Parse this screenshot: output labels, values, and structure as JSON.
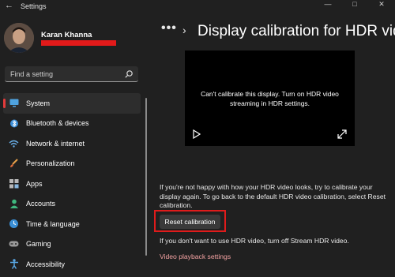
{
  "window": {
    "title": "Settings",
    "back_icon": "back-arrow-icon",
    "controls": [
      "minimize",
      "maximize",
      "close"
    ]
  },
  "profile": {
    "name": "Karan Khanna",
    "redaction_color": "#e21a1a"
  },
  "search": {
    "placeholder": "Find a setting",
    "icon": "search-icon"
  },
  "sidebar": {
    "items": [
      {
        "label": "System",
        "icon": "monitor-icon",
        "selected": true
      },
      {
        "label": "Bluetooth & devices",
        "icon": "bluetooth-icon"
      },
      {
        "label": "Network & internet",
        "icon": "wifi-icon"
      },
      {
        "label": "Personalization",
        "icon": "brush-icon"
      },
      {
        "label": "Apps",
        "icon": "apps-icon"
      },
      {
        "label": "Accounts",
        "icon": "person-icon"
      },
      {
        "label": "Time & language",
        "icon": "globe-clock-icon"
      },
      {
        "label": "Gaming",
        "icon": "gamepad-icon"
      },
      {
        "label": "Accessibility",
        "icon": "accessibility-icon"
      }
    ],
    "accent_color": "#e23b3b"
  },
  "header": {
    "more": "•••",
    "chevron": "›",
    "title": "Display calibration for HDR vide"
  },
  "video": {
    "message": "Can't calibrate this display. Turn on HDR video streaming in HDR settings.",
    "play_icon": "play-icon",
    "expand_icon": "expand-icon"
  },
  "content": {
    "info": "If you're not happy with how your HDR video looks, try to calibrate your display again. To go back to the default HDR video calibration, select Reset calibration.",
    "reset_label": "Reset calibration",
    "stream_text": "If you don't want to use HDR video, turn off Stream HDR video.",
    "playback_link": "Video playback settings",
    "link_color": "#f3a2a2",
    "highlight_color": "#e01b1b"
  }
}
